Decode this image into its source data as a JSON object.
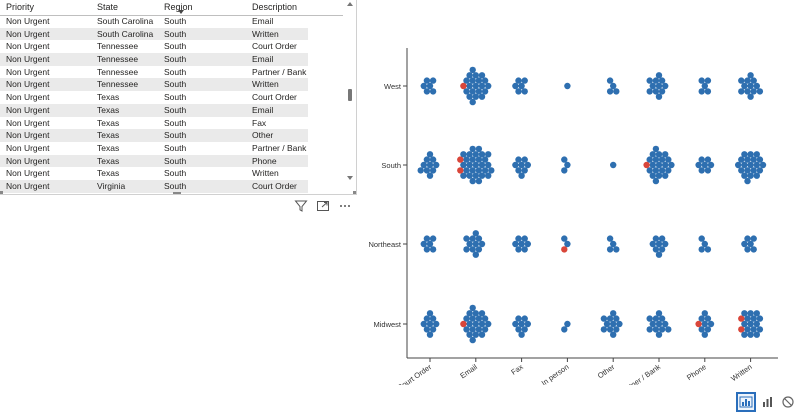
{
  "table": {
    "columns": [
      "Priority",
      "State",
      "Region",
      "Description"
    ],
    "rows": [
      [
        "Non Urgent",
        "South Carolina",
        "South",
        "Email"
      ],
      [
        "Non Urgent",
        "South Carolina",
        "South",
        "Written"
      ],
      [
        "Non Urgent",
        "Tennessee",
        "South",
        "Court Order"
      ],
      [
        "Non Urgent",
        "Tennessee",
        "South",
        "Email"
      ],
      [
        "Non Urgent",
        "Tennessee",
        "South",
        "Partner / Bank"
      ],
      [
        "Non Urgent",
        "Tennessee",
        "South",
        "Written"
      ],
      [
        "Non Urgent",
        "Texas",
        "South",
        "Court Order"
      ],
      [
        "Non Urgent",
        "Texas",
        "South",
        "Email"
      ],
      [
        "Non Urgent",
        "Texas",
        "South",
        "Fax"
      ],
      [
        "Non Urgent",
        "Texas",
        "South",
        "Other"
      ],
      [
        "Non Urgent",
        "Texas",
        "South",
        "Partner / Bank"
      ],
      [
        "Non Urgent",
        "Texas",
        "South",
        "Phone"
      ],
      [
        "Non Urgent",
        "Texas",
        "South",
        "Written"
      ],
      [
        "Non Urgent",
        "Virginia",
        "South",
        "Court Order"
      ]
    ]
  },
  "visual_header_icons": [
    "filter-icon",
    "focus-mode-icon",
    "more-options-icon"
  ],
  "bottom_toolbar_icons": [
    "chart-view-icon",
    "bar-chart-icon",
    "no-data-icon"
  ],
  "colors": {
    "dot_blue": "#2e6fb0",
    "dot_red": "#d9463a",
    "axis": "#444444"
  },
  "chart_data": {
    "type": "scatter",
    "subtype": "beeswarm",
    "categories": [
      "Court Order",
      "Email",
      "Fax",
      "In person",
      "Other",
      "Partner / Bank",
      "Phone",
      "Written"
    ],
    "groups": [
      "West",
      "South",
      "Northeast",
      "Midwest"
    ],
    "x_tick_labels": [
      "Court Order",
      "Email",
      "Fax",
      "In person",
      "Other",
      "Partner / Bank",
      "Phone",
      "Written"
    ],
    "series": [
      {
        "values": [
          [
            6,
            20,
            6,
            1,
            4,
            11,
            5,
            12
          ],
          [
            10,
            28,
            8,
            3,
            1,
            20,
            7,
            20
          ],
          [
            6,
            11,
            7,
            2,
            4,
            8,
            4,
            6
          ],
          [
            9,
            20,
            8,
            2,
            11,
            12,
            8,
            15
          ]
        ]
      },
      {
        "color": "red",
        "values": [
          [
            0,
            1,
            0,
            0,
            0,
            0,
            0,
            0
          ],
          [
            0,
            2,
            0,
            0,
            0,
            1,
            0,
            0
          ],
          [
            0,
            0,
            0,
            1,
            0,
            0,
            0,
            0
          ],
          [
            0,
            1,
            0,
            0,
            0,
            0,
            1,
            2
          ]
        ]
      }
    ],
    "grid": false,
    "legend": "none"
  }
}
